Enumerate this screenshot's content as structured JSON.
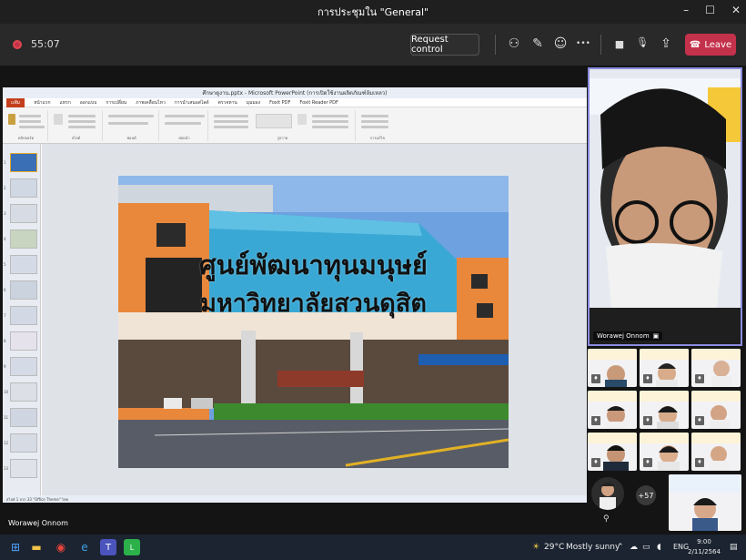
{
  "window": {
    "title": "การประชุมใน \"General\"",
    "controls": [
      "–",
      "☐",
      "✕"
    ]
  },
  "toolbar": {
    "timer": "55:07",
    "request_control_label": "Request control",
    "leave_label": "Leave",
    "icons": [
      "participants-icon",
      "chat-icon",
      "reactions-icon",
      "more-options-icon",
      "camera-icon",
      "mic-off-icon",
      "share-icon"
    ],
    "glyphs": {
      "participants": "⚇",
      "chat": "✎",
      "reactions": "☺",
      "more": "•••",
      "camera": "■",
      "mic": "🎙",
      "share": "⇪",
      "phone": "☎"
    }
  },
  "powerpoint": {
    "title": "ศึกษาดูงาน.pptx - Microsoft PowerPoint (การเปิดใช้งานผลิตภัณฑ์ล้มเหลว)",
    "tabs": [
      "แฟ้ม",
      "หน้าแรก",
      "แทรก",
      "ออกแบบ",
      "การเปลี่ยน",
      "ภาพเคลื่อนไหว",
      "การนำเสนอสไลด์",
      "ตรวจทาน",
      "มุมมอง",
      "Foxit PDF",
      "Foxit Reader PDF"
    ],
    "ribbon_groups": [
      "คลิปบอร์ด",
      "สไลด์",
      "ฟอนต์",
      "ย่อหน้า",
      "รูปวาด",
      "การแก้ไข"
    ],
    "status_text": "สไลด์ 1 จาก 33   \"Office Theme\"   ไทย",
    "thumbnail_numbers": [
      "1",
      "2",
      "3",
      "4",
      "5",
      "6",
      "7",
      "8",
      "9",
      "10",
      "11",
      "12",
      "13"
    ],
    "slide": {
      "line1": "ศูนย์พัฒนาทุนมนุษย์",
      "line2": "มหาวิทยาลัยสวนดุสิต"
    }
  },
  "participants": {
    "main_speaker": "Worawej Onnom",
    "more_count": "+57",
    "tile_badges": [
      "♦",
      "♦",
      "♦",
      "♦",
      "♦",
      "♦",
      "♦",
      "♦",
      "♦"
    ]
  },
  "presenter_label": "Worawej Onnom",
  "taskbar": {
    "weather_temp": "29°C",
    "weather_text": "Mostly sunny",
    "language": "ENG",
    "time": "9:00",
    "date": "2/11/2564"
  },
  "colors": {
    "leave": "#c4314b",
    "accent_border": "#8b8ce0",
    "ppt_file_tab": "#c43e1c"
  }
}
